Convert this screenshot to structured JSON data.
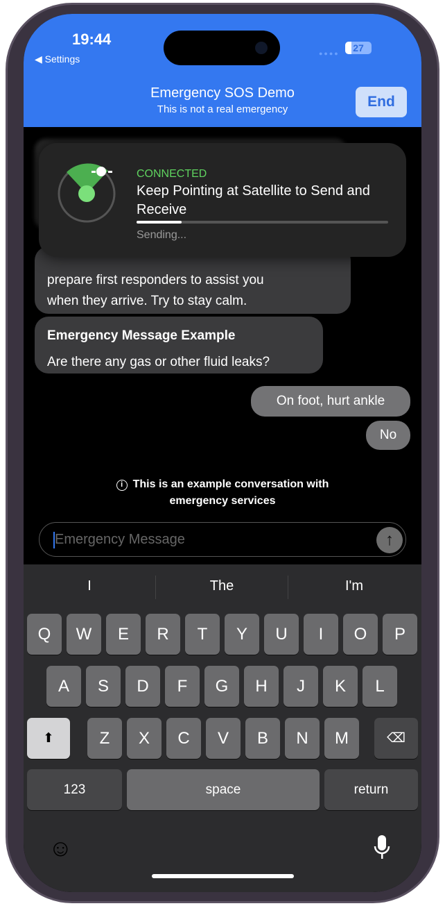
{
  "status_bar": {
    "time": "19:44",
    "back_label": "Settings",
    "battery": "27"
  },
  "header": {
    "title": "Emergency SOS Demo",
    "subtitle": "This is not a real emergency",
    "end_label": "End",
    "color": "#3478f0"
  },
  "banner": {
    "status": "CONNECTED",
    "title": "Keep Pointing at Satellite to Send and Receive",
    "progress": 0.18,
    "progress_label": "Sending...",
    "icon": "satellite-radar-icon"
  },
  "messages": [
    {
      "from": "dispatcher",
      "lines": [
        "prepare first responders to assist you",
        "when they arrive. Try to stay calm."
      ]
    },
    {
      "from": "dispatcher",
      "heading": "Emergency Message Example",
      "text": "Are there any gas or other fluid leaks?"
    },
    {
      "from": "me",
      "text": "On foot, hurt ankle"
    },
    {
      "from": "me",
      "text": "No"
    }
  ],
  "info": {
    "text": "This is an example conversation with emergency services",
    "icon": "info-icon"
  },
  "composer": {
    "placeholder": "Emergency Message",
    "value": ""
  },
  "keyboard": {
    "suggestions": [
      "I",
      "The",
      "I'm"
    ],
    "row1": [
      "Q",
      "W",
      "E",
      "R",
      "T",
      "Y",
      "U",
      "I",
      "O",
      "P"
    ],
    "row2": [
      "A",
      "S",
      "D",
      "F",
      "G",
      "H",
      "J",
      "K",
      "L"
    ],
    "row3": [
      "Z",
      "X",
      "C",
      "V",
      "B",
      "N",
      "M"
    ],
    "numbers_label": "123",
    "space_label": "space",
    "return_label": "return"
  }
}
